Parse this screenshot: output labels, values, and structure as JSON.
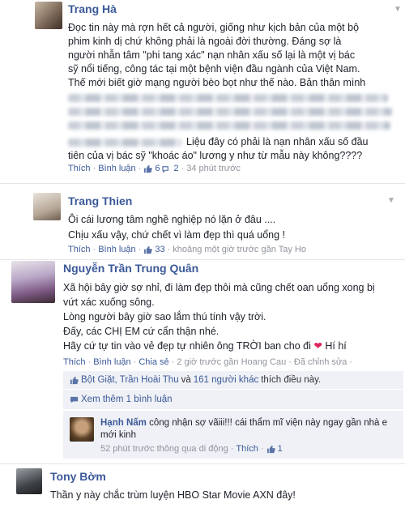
{
  "post1": {
    "name": "Trang Hà",
    "lines": [
      "Đọc tin này mà rợn hết cả người, giống như kịch bản của một bộ",
      "phim kinh dị chứ không phải là ngoài đời thường. Đáng sợ là",
      "người nhẫn tâm \"phi tang xác\" nạn nhân xấu số lại là một vị bác",
      "sỹ nổi tiếng, công tác tại một bệnh viện đầu ngành của Việt Nam.",
      "Thế mới biết giờ mạng người bèo bọt như thế nào. Bản thân mình"
    ],
    "tail1": "Liệu đây có phải là nạn nhân xấu số đầu",
    "tail2": "tiên của vị bác sỹ \"khoác áo\" lương y như từ mẫu này không????",
    "like": "Thích",
    "comment": "Bình luận",
    "likes": "6",
    "shares": "2",
    "time": "34 phút trước"
  },
  "post2": {
    "name": "Trang Thien",
    "line1": "Ôi cái lương tâm nghề nghiệp nó lặn ở đâu ....",
    "line2": "Chịu xấu vậy, chứ chết vì làm đẹp thì quá uổng !",
    "like": "Thích",
    "comment": "Bình luận",
    "likes": "33",
    "time": "khoảng một giờ trước gần Tay Ho"
  },
  "post3": {
    "name": "Nguyễn Trần Trung Quân",
    "line1": "Xã hội bây giờ sợ nhỉ, đi làm đẹp thôi mà cũng chết oan uổng xong bị",
    "line2": "vứt xác xuống sông.",
    "line3": "Lòng người bây giờ sao lắm thú tính vậy trời.",
    "line4": "Đấy, các CHỊ EM cứ cẩn thận nhé.",
    "line5": "Hãy cứ tự tin vào vẻ đẹp tự nhiên ông TRỜI ban cho đi",
    "line5b": "Hí hí",
    "like": "Thích",
    "comment": "Bình luận",
    "share": "Chia sẻ",
    "time": "2 giờ trước gần Hoang Cau",
    "edited": "Đã chỉnh sửa",
    "likers": "Bột Giặt, Trần Hoài Thu",
    "likers_and": "và",
    "likers_more": "161 người khác",
    "likers_suffix": "thích điều này.",
    "more_comments": "Xem thêm 1 bình luận",
    "reply": {
      "name": "Hạnh Nấm",
      "text1": "công nhận sợ vãiii!!! cái thẩm mĩ viện này ngay gần nhà e",
      "text2": "mới kinh",
      "time": "52 phút trước thông qua di động",
      "like": "Thích",
      "likes": "1"
    }
  },
  "post4": {
    "name": "Tony Bờm",
    "line1": "Thần y này chắc trùm luyện HBO Star Movie AXN đây!"
  }
}
